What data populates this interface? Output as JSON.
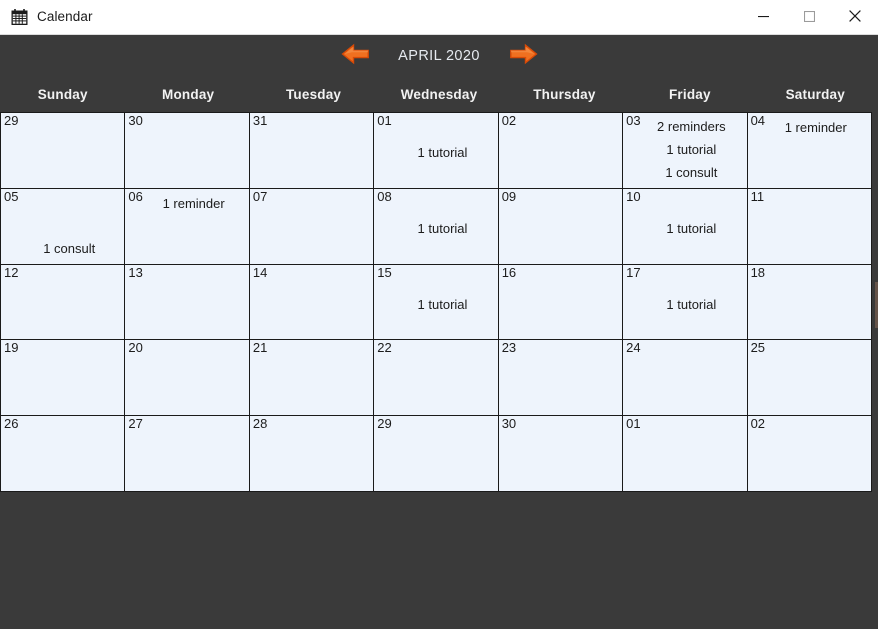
{
  "window": {
    "title": "Calendar",
    "icon": "calendar-icon",
    "minimize_label": "—",
    "maximize_label": "□",
    "close_label": "✕"
  },
  "nav": {
    "prev_icon": "left-arrow-icon",
    "next_icon": "right-arrow-icon",
    "month_label": "APRIL 2020",
    "arrow_color": "#e8590c"
  },
  "colors": {
    "chrome": "#3a3a3a",
    "cell": "#eef4fc",
    "grid_line": "#1a1a1a",
    "header_text": "#f2f2f2",
    "month_text": "#e6eaf0"
  },
  "weekdays": [
    "Sunday",
    "Monday",
    "Tuesday",
    "Wednesday",
    "Thursday",
    "Friday",
    "Saturday"
  ],
  "cells": [
    {
      "date": "29",
      "events": []
    },
    {
      "date": "30",
      "events": []
    },
    {
      "date": "31",
      "events": []
    },
    {
      "date": "01",
      "events": [
        "",
        "1 tutorial"
      ]
    },
    {
      "date": "02",
      "events": []
    },
    {
      "date": "03",
      "events": [
        "2 reminders",
        "1 tutorial",
        "1 consult"
      ]
    },
    {
      "date": "04",
      "events": [
        "1 reminder"
      ]
    },
    {
      "date": "05",
      "events": [
        "",
        "",
        "1 consult"
      ]
    },
    {
      "date": "06",
      "events": [
        "1 reminder"
      ]
    },
    {
      "date": "07",
      "events": []
    },
    {
      "date": "08",
      "events": [
        "",
        "1 tutorial"
      ]
    },
    {
      "date": "09",
      "events": []
    },
    {
      "date": "10",
      "events": [
        "",
        "1 tutorial"
      ]
    },
    {
      "date": "11",
      "events": []
    },
    {
      "date": "12",
      "events": []
    },
    {
      "date": "13",
      "events": []
    },
    {
      "date": "14",
      "events": []
    },
    {
      "date": "15",
      "events": [
        "",
        "1 tutorial"
      ]
    },
    {
      "date": "16",
      "events": []
    },
    {
      "date": "17",
      "events": [
        "",
        "1 tutorial"
      ]
    },
    {
      "date": "18",
      "events": []
    },
    {
      "date": "19",
      "events": []
    },
    {
      "date": "20",
      "events": []
    },
    {
      "date": "21",
      "events": []
    },
    {
      "date": "22",
      "events": []
    },
    {
      "date": "23",
      "events": []
    },
    {
      "date": "24",
      "events": []
    },
    {
      "date": "25",
      "events": []
    },
    {
      "date": "26",
      "events": []
    },
    {
      "date": "27",
      "events": []
    },
    {
      "date": "28",
      "events": []
    },
    {
      "date": "29",
      "events": []
    },
    {
      "date": "30",
      "events": []
    },
    {
      "date": "01",
      "events": []
    },
    {
      "date": "02",
      "events": []
    }
  ]
}
